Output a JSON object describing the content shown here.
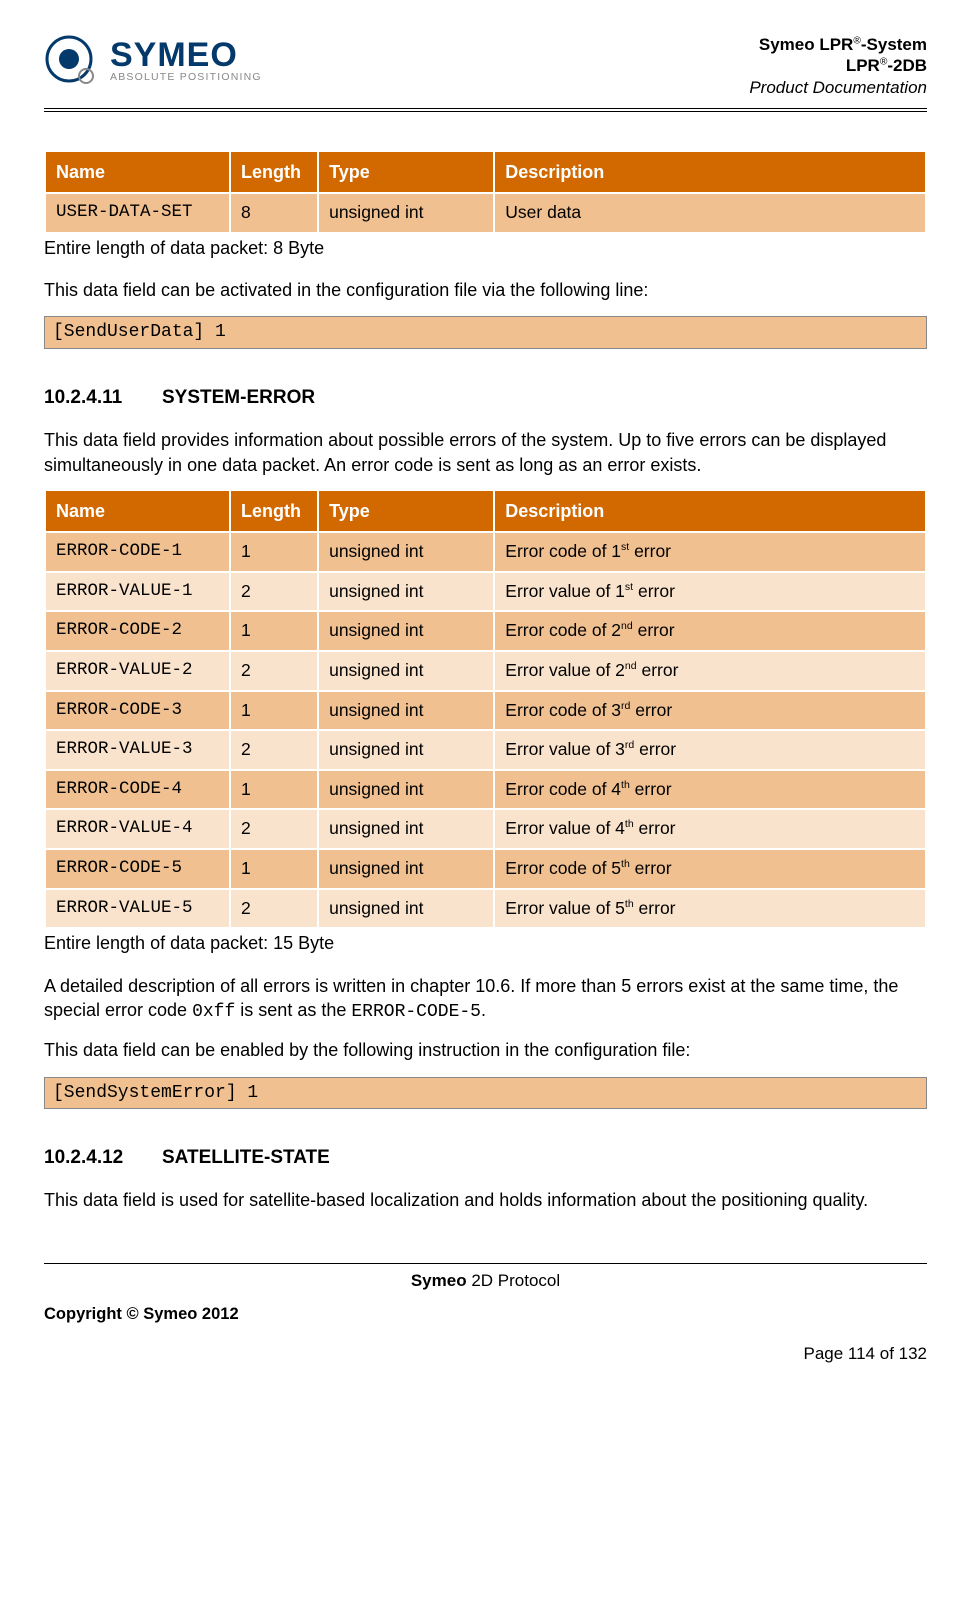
{
  "header": {
    "logo_main": "SYMEO",
    "logo_sub": "ABSOLUTE POSITIONING",
    "line1_a": "Symeo LPR",
    "line1_b": "-System",
    "line2_a": "LPR",
    "line2_b": "-2DB",
    "line3": "Product Documentation",
    "reg": "®"
  },
  "table1": {
    "headers": {
      "name": "Name",
      "length": "Length",
      "type": "Type",
      "desc": "Description"
    },
    "rows": [
      {
        "name": "USER-DATA-SET",
        "length": "8",
        "type": "unsigned int",
        "desc": "User data"
      }
    ],
    "footer": "Entire length of data packet: 8 Byte"
  },
  "p1": "This data field can be activated in the configuration file via the following line:",
  "code1": "[SendUserData]  1",
  "sec1": {
    "num": "10.2.4.11",
    "title": "SYSTEM-ERROR"
  },
  "p2": "This data field provides information about possible errors of the system. Up to five errors can be displayed simultaneously in one data packet. An error code is sent as long as an error exists.",
  "table2": {
    "headers": {
      "name": "Name",
      "length": "Length",
      "type": "Type",
      "desc": "Description"
    },
    "rows": [
      {
        "name": "ERROR-CODE-1",
        "length": "1",
        "type": "unsigned int",
        "desc_a": "Error code of  1",
        "desc_sup": "st",
        "desc_b": " error"
      },
      {
        "name": "ERROR-VALUE-1",
        "length": "2",
        "type": "unsigned int",
        "desc_a": "Error value of  1",
        "desc_sup": "st",
        "desc_b": " error"
      },
      {
        "name": "ERROR-CODE-2",
        "length": "1",
        "type": "unsigned int",
        "desc_a": "Error code of  2",
        "desc_sup": "nd",
        "desc_b": " error"
      },
      {
        "name": "ERROR-VALUE-2",
        "length": "2",
        "type": "unsigned int",
        "desc_a": "Error value of  2",
        "desc_sup": "nd",
        "desc_b": " error"
      },
      {
        "name": "ERROR-CODE-3",
        "length": "1",
        "type": "unsigned int",
        "desc_a": "Error code of  3",
        "desc_sup": "rd",
        "desc_b": " error"
      },
      {
        "name": "ERROR-VALUE-3",
        "length": "2",
        "type": "unsigned int",
        "desc_a": "Error value of  3",
        "desc_sup": "rd",
        "desc_b": "  error"
      },
      {
        "name": "ERROR-CODE-4",
        "length": "1",
        "type": "unsigned int",
        "desc_a": "Error code of  4",
        "desc_sup": "th",
        "desc_b": " error"
      },
      {
        "name": "ERROR-VALUE-4",
        "length": "2",
        "type": "unsigned int",
        "desc_a": "Error value of  4",
        "desc_sup": "th",
        "desc_b": " error"
      },
      {
        "name": "ERROR-CODE-5",
        "length": "1",
        "type": "unsigned int",
        "desc_a": "Error code of  5",
        "desc_sup": "th",
        "desc_b": " error"
      },
      {
        "name": "ERROR-VALUE-5",
        "length": "2",
        "type": "unsigned int",
        "desc_a": "Error value of  5",
        "desc_sup": "th",
        "desc_b": " error"
      }
    ],
    "footer": "Entire length of data packet: 15 Byte"
  },
  "p3_a": "A detailed description of all errors is written in chapter 10.6. If more than 5 errors exist at the same time, the special error code ",
  "p3_code1": "0xff",
  "p3_b": " is sent as the ",
  "p3_code2": "ERROR-CODE-5",
  "p3_c": ".",
  "p4": "This data field can be enabled by the following instruction in the configuration file:",
  "code2": "[SendSystemError]  1",
  "sec2": {
    "num": "10.2.4.12",
    "title": "SATELLITE-STATE"
  },
  "p5": "This data field is used for satellite-based localization and holds information about the positioning quality.",
  "footer": {
    "center_bold": "Symeo",
    "center_rest": " 2D Protocol",
    "copyright": "Copyright © Symeo 2012",
    "page": "Page 114 of 132"
  }
}
